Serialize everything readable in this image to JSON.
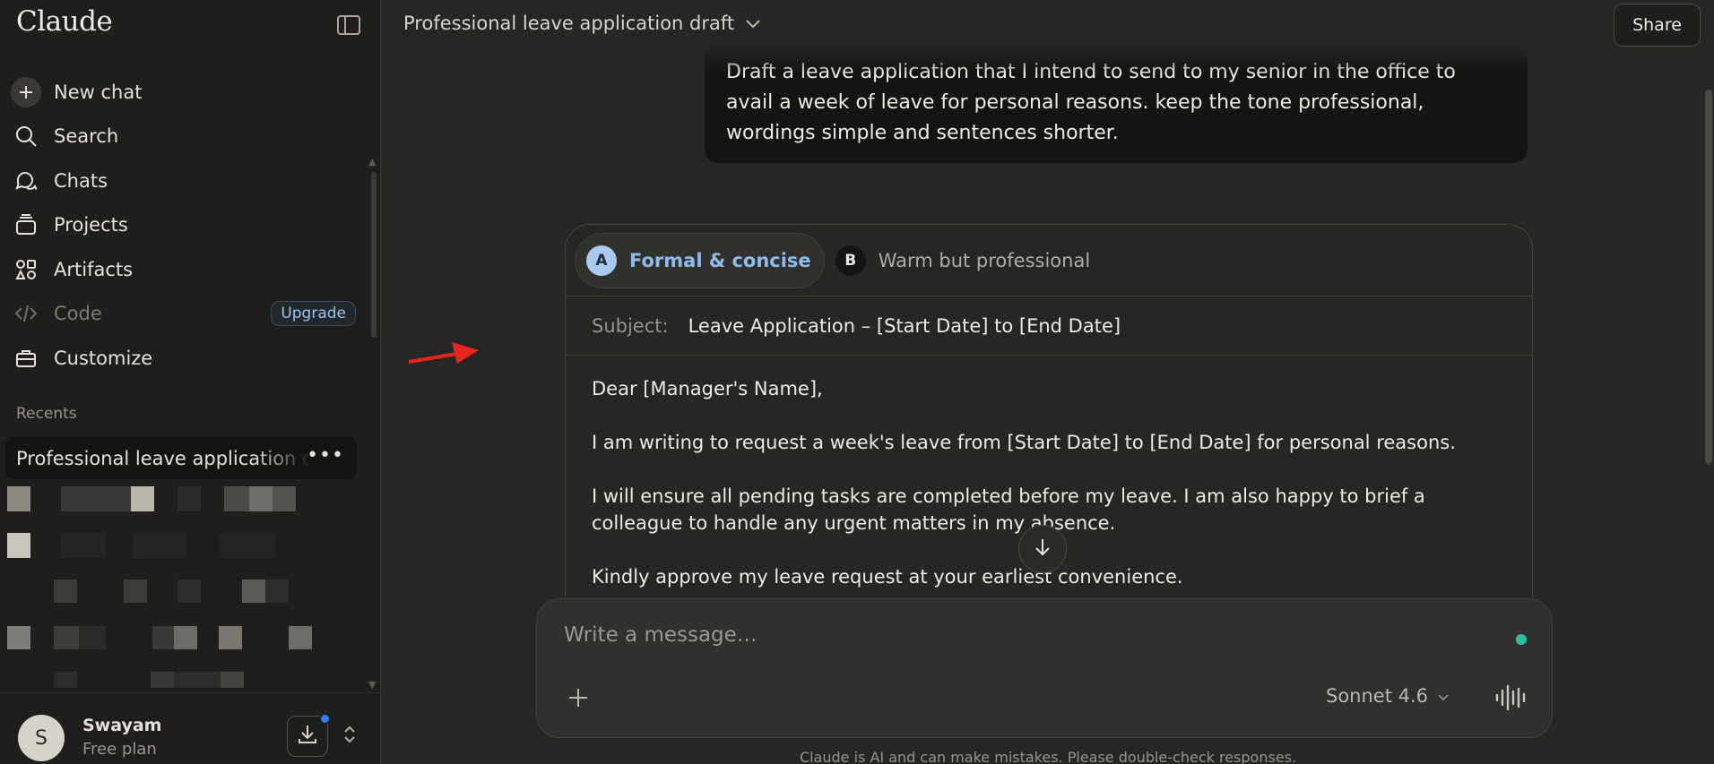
{
  "app": {
    "name": "Claude"
  },
  "sidebar": {
    "nav": [
      {
        "label": "New chat",
        "icon": "plus-icon"
      },
      {
        "label": "Search",
        "icon": "search-icon"
      },
      {
        "label": "Chats",
        "icon": "chats-icon"
      },
      {
        "label": "Projects",
        "icon": "projects-icon"
      },
      {
        "label": "Artifacts",
        "icon": "artifacts-icon"
      },
      {
        "label": "Code",
        "icon": "code-icon",
        "badge": "Upgrade"
      },
      {
        "label": "Customize",
        "icon": "customize-icon"
      }
    ],
    "recents_label": "Recents",
    "active_recent": "Professional leave application draft",
    "more_label": "•••",
    "user": {
      "initial": "S",
      "name": "Swayam",
      "plan": "Free plan"
    }
  },
  "header": {
    "chat_title": "Professional leave application draft",
    "share_label": "Share"
  },
  "conversation": {
    "user_message": "Draft a leave application that I intend to send to my senior in the office to avail a week of leave for personal reasons. keep the tone professional, wordings simple and sentences shorter.",
    "tabs": [
      {
        "badge": "A",
        "label": "Formal & concise",
        "active": true
      },
      {
        "badge": "B",
        "label": "Warm but professional",
        "active": false
      }
    ],
    "subject_label": "Subject:",
    "subject_value": "Leave Application – [Start Date] to [End Date]",
    "body": [
      "Dear [Manager's Name],",
      "I am writing to request a week's leave from [Start Date] to [End Date] for personal reasons.",
      "I will ensure all pending tasks are completed before my leave. I am also happy to brief a colleague to handle any urgent matters in my absence.",
      "Kindly approve my leave request at your earliest convenience."
    ]
  },
  "composer": {
    "placeholder": "Write a message…",
    "model": "Sonnet 4.6"
  },
  "disclaimer": "Claude is AI and can make mistakes. Please double-check responses.",
  "colors": {
    "accent_blue": "#8fbcef",
    "status_green": "#2dbfa6",
    "notification_blue": "#2e7ff2",
    "annotation_red": "#e5261f"
  }
}
